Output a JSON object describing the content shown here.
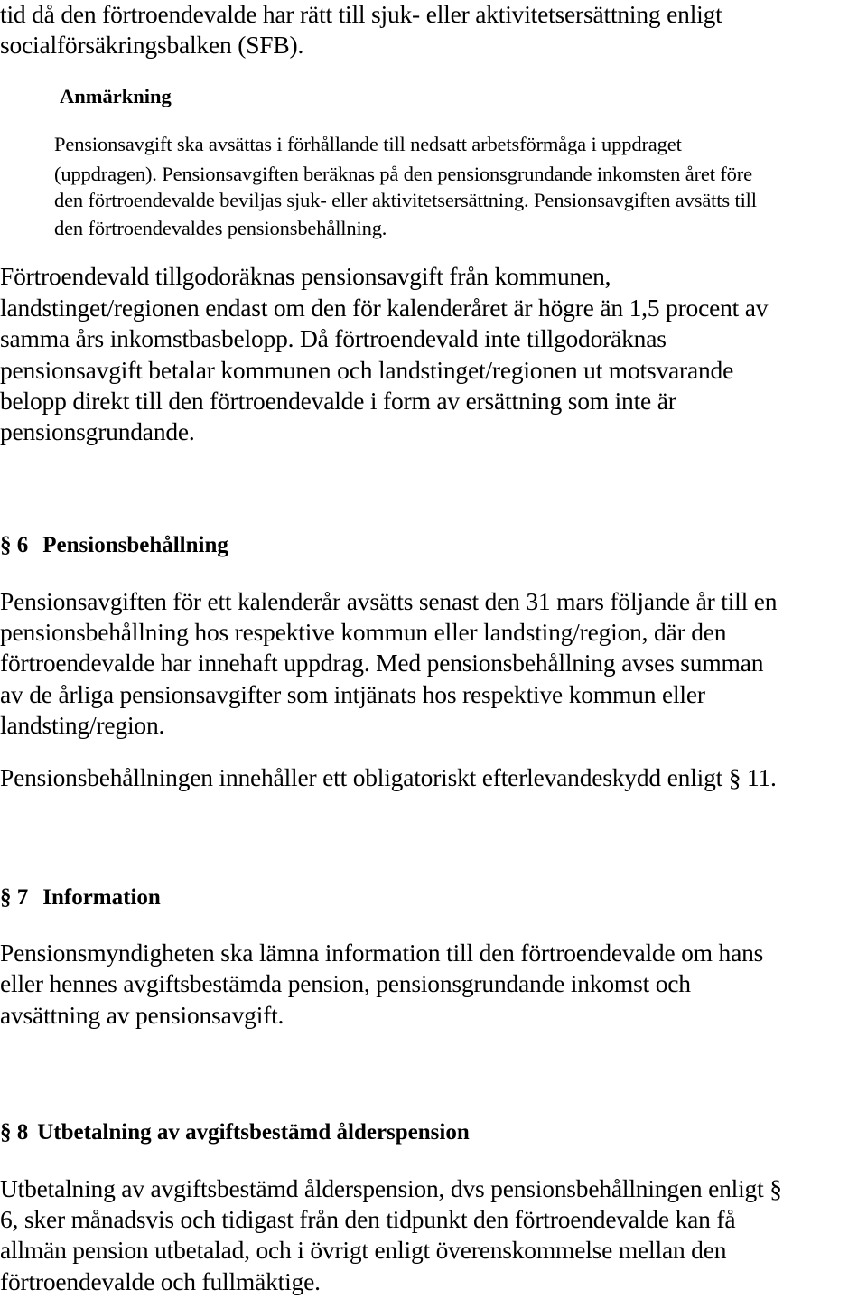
{
  "document": {
    "intro": {
      "lines": [
        "tid då den förtroendevalde har rätt till sjuk- eller aktivitetsersättning enligt",
        "socialförsäkringsbalken (SFB)."
      ]
    },
    "remark": {
      "heading": "Anmärkning",
      "lines": [
        "Pensionsavgift ska avsättas i förhållande till nedsatt arbetsförmåga i uppdraget",
        "(uppdragen). Pensionsavgiften beräknas på den pensionsgrundande inkomsten året före",
        "den förtroendevalde beviljas sjuk- eller aktivitetsersättning. Pensionsavgiften avsätts till",
        "den förtroendevaldes pensionsbehållning."
      ]
    },
    "paragraph_credit": {
      "lines": [
        "Förtroendevald tillgodoräknas pensionsavgift från kommunen,",
        "landstinget/regionen endast om den för kalenderåret är högre än 1,5 procent av",
        "samma års inkomstbasbelopp. Då förtroendevald inte tillgodoräknas",
        "pensionsavgift betalar kommunen och landstinget/regionen ut motsvarande",
        "belopp direkt till den förtroendevalde i form av ersättning som inte är",
        "pensionsgrundande."
      ]
    },
    "sections": [
      {
        "number": "§ 6",
        "title": "Pensionsbehållning",
        "paragraphs": [
          [
            "Pensionsavgiften för ett kalenderår avsätts senast den 31 mars följande år till en",
            "pensionsbehållning hos respektive kommun eller landsting/region, där den",
            "förtroendevalde har innehaft uppdrag. Med pensionsbehållning avses summan",
            "av de årliga pensionsavgifter som intjänats hos respektive kommun eller",
            "landsting/region."
          ],
          [
            "Pensionsbehållningen innehåller ett obligatoriskt efterlevandeskydd enligt § 11."
          ]
        ]
      },
      {
        "number": "§ 7",
        "title": "Information",
        "paragraphs": [
          [
            "Pensionsmyndigheten ska lämna information till den förtroendevalde om hans",
            "eller hennes avgiftsbestämda pension, pensionsgrundande inkomst och",
            "avsättning av pensionsavgift."
          ]
        ]
      },
      {
        "number": "§ 8",
        "title": "Utbetalning av avgiftsbestämd ålderspension",
        "paragraphs": [
          [
            "Utbetalning av avgiftsbestämd ålderspension, dvs pensionsbehållningen enligt §",
            "6, sker månadsvis och tidigast från den tidpunkt den förtroendevalde kan få",
            "allmän pension utbetalad, och i övrigt enligt överenskommelse mellan den",
            "förtroendevalde och fullmäktige."
          ]
        ]
      }
    ]
  }
}
